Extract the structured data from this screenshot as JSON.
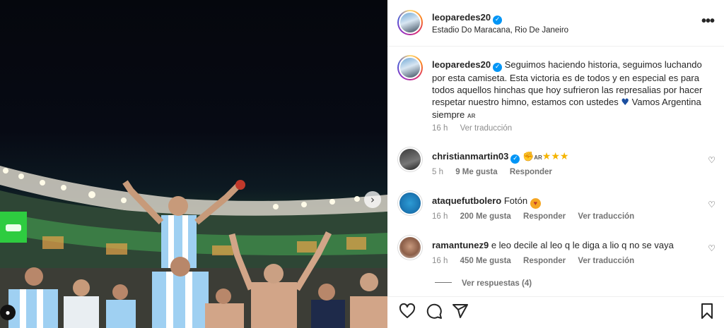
{
  "post": {
    "username": "leoparedes20",
    "location": "Estadio Do Maracana, Rio De Janeiro",
    "more_label": "•••"
  },
  "caption": {
    "username": "leoparedes20",
    "text": "Seguimos haciendo historia, seguimos luchando por esta camiseta. Esta victoria es de todos y en especial es para todos aquellos hinchas que hoy sufrieron las represalias por hacer respetar nuestro himno, estamos con ustedes",
    "text_after": "Vamos Argentina siempre",
    "flag": "AR",
    "time": "16 h",
    "translate": "Ver traducción"
  },
  "comments": [
    {
      "username": "christianmartin03",
      "text": "",
      "flag": "AR",
      "time": "5 h",
      "likes": "9 Me gusta",
      "reply": "Responder",
      "translate": ""
    },
    {
      "username": "ataquefutbolero",
      "text": "Fotón",
      "time": "16 h",
      "likes": "200 Me gusta",
      "reply": "Responder",
      "translate": "Ver traducción"
    },
    {
      "username": "ramantunez9",
      "text": "e leo decile al leo q le diga a lio q no se vaya",
      "time": "16 h",
      "likes": "450 Me gusta",
      "reply": "Responder",
      "translate": "Ver traducción"
    }
  ],
  "view_replies": "Ver respuestas (4)",
  "icons": {
    "heart": "heart-icon",
    "comment": "comment-icon",
    "share": "share-icon",
    "bookmark": "bookmark-icon",
    "next": "chevron-right-icon",
    "user_tag": "user-tag-icon"
  },
  "colors": {
    "verified": "#0095f6",
    "muted": "#8e8e8e",
    "text": "#262626"
  }
}
